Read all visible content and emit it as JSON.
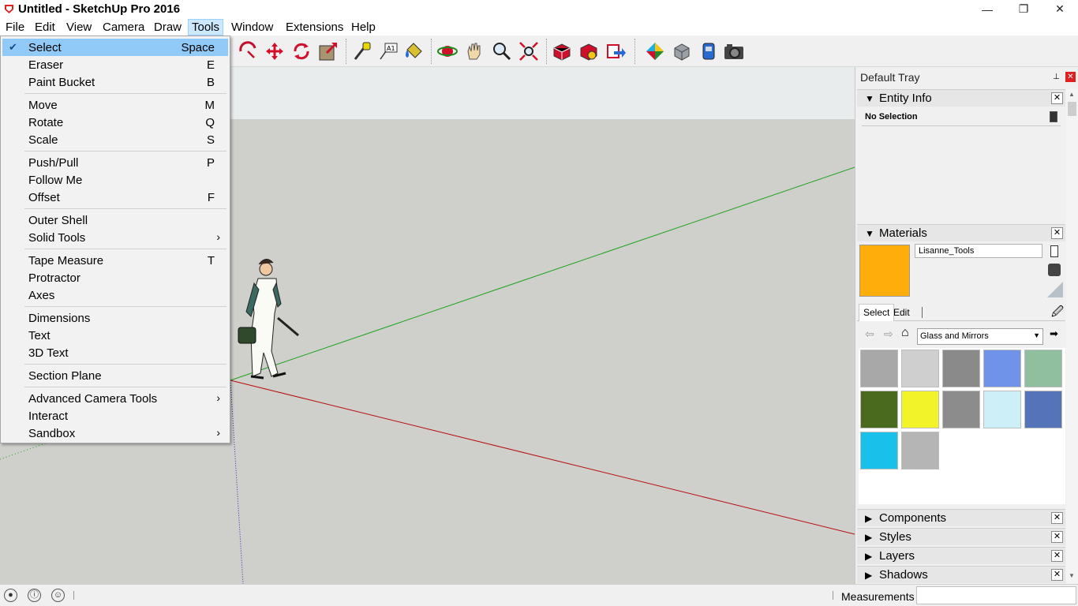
{
  "window": {
    "title": "Untitled - SketchUp Pro 2016",
    "controls": {
      "minimize": "—",
      "restore": "❐",
      "close": "✕"
    }
  },
  "menubar": {
    "items": [
      "File",
      "Edit",
      "View",
      "Camera",
      "Draw",
      "Tools",
      "Window",
      "Extensions",
      "Help"
    ],
    "active": "Tools"
  },
  "tools_menu": {
    "items": [
      {
        "label": "Select",
        "shortcut": "Space",
        "checked": true
      },
      {
        "label": "Eraser",
        "shortcut": "E"
      },
      {
        "label": "Paint Bucket",
        "shortcut": "B"
      },
      {
        "label": "Move",
        "shortcut": "M"
      },
      {
        "label": "Rotate",
        "shortcut": "Q"
      },
      {
        "label": "Scale",
        "shortcut": "S"
      },
      {
        "label": "Push/Pull",
        "shortcut": "P"
      },
      {
        "label": "Follow Me",
        "shortcut": ""
      },
      {
        "label": "Offset",
        "shortcut": "F"
      },
      {
        "label": "Outer Shell",
        "shortcut": ""
      },
      {
        "label": "Solid Tools",
        "shortcut": "",
        "submenu": true
      },
      {
        "label": "Tape Measure",
        "shortcut": "T"
      },
      {
        "label": "Protractor",
        "shortcut": ""
      },
      {
        "label": "Axes",
        "shortcut": ""
      },
      {
        "label": "Dimensions",
        "shortcut": ""
      },
      {
        "label": "Text",
        "shortcut": ""
      },
      {
        "label": "3D Text",
        "shortcut": ""
      },
      {
        "label": "Section Plane",
        "shortcut": ""
      },
      {
        "label": "Advanced Camera Tools",
        "shortcut": "",
        "submenu": true
      },
      {
        "label": "Interact",
        "shortcut": ""
      },
      {
        "label": "Sandbox",
        "shortcut": "",
        "submenu": true
      }
    ],
    "check_glyph": "✔",
    "submenu_glyph": "›"
  },
  "toolbar": {
    "icons": [
      "rotate-tool-icon",
      "move-tool-icon",
      "rotate-arrows-icon",
      "scale-tool-icon",
      "tape-measure-icon",
      "text-tool-icon",
      "paint-bucket-icon",
      "orbit-icon",
      "pan-icon",
      "zoom-icon",
      "zoom-extents-icon",
      "warehouse-icon",
      "extension-warehouse-icon",
      "share-model-icon",
      "styles-icon",
      "component-icon",
      "layer-icon",
      "camera-icon"
    ]
  },
  "tray": {
    "title": "Default Tray",
    "pin_glyph": "📌",
    "close_glyph": "✕",
    "entity_info": {
      "header": "Entity Info",
      "status": "No Selection"
    },
    "materials": {
      "header": "Materials",
      "name_value": "Lisanne_Tools",
      "current_color": "#ffad0a",
      "tabs": [
        "Select",
        "Edit"
      ],
      "library": "Glass and Mirrors",
      "swatches": [
        "#a8a8a8",
        "#cfcfcf",
        "#8a8a8a",
        "#6f93e8",
        "#8fbf9f",
        "#4a6a1e",
        "#f3f32a",
        "#8c8c8c",
        "#cdeff7",
        "#5573b8",
        "#19c0ea",
        "#b5b5b5"
      ]
    },
    "collapsed_panels": [
      "Components",
      "Styles",
      "Layers",
      "Shadows"
    ],
    "arrow_open": "▼",
    "arrow_closed": "▶"
  },
  "statusbar": {
    "measurements_label": "Measurements",
    "measurements_value": "",
    "icons": [
      "geo-location-icon",
      "credits-icon",
      "user-icon"
    ]
  },
  "colors": {
    "sky": "#e9ecec",
    "ground": "#cfcfcb",
    "green_axis": "#1aa51a",
    "red_axis": "#b80e0e",
    "blue_axis": "#2a2ab0",
    "menu_highlight": "#91c9f7"
  }
}
